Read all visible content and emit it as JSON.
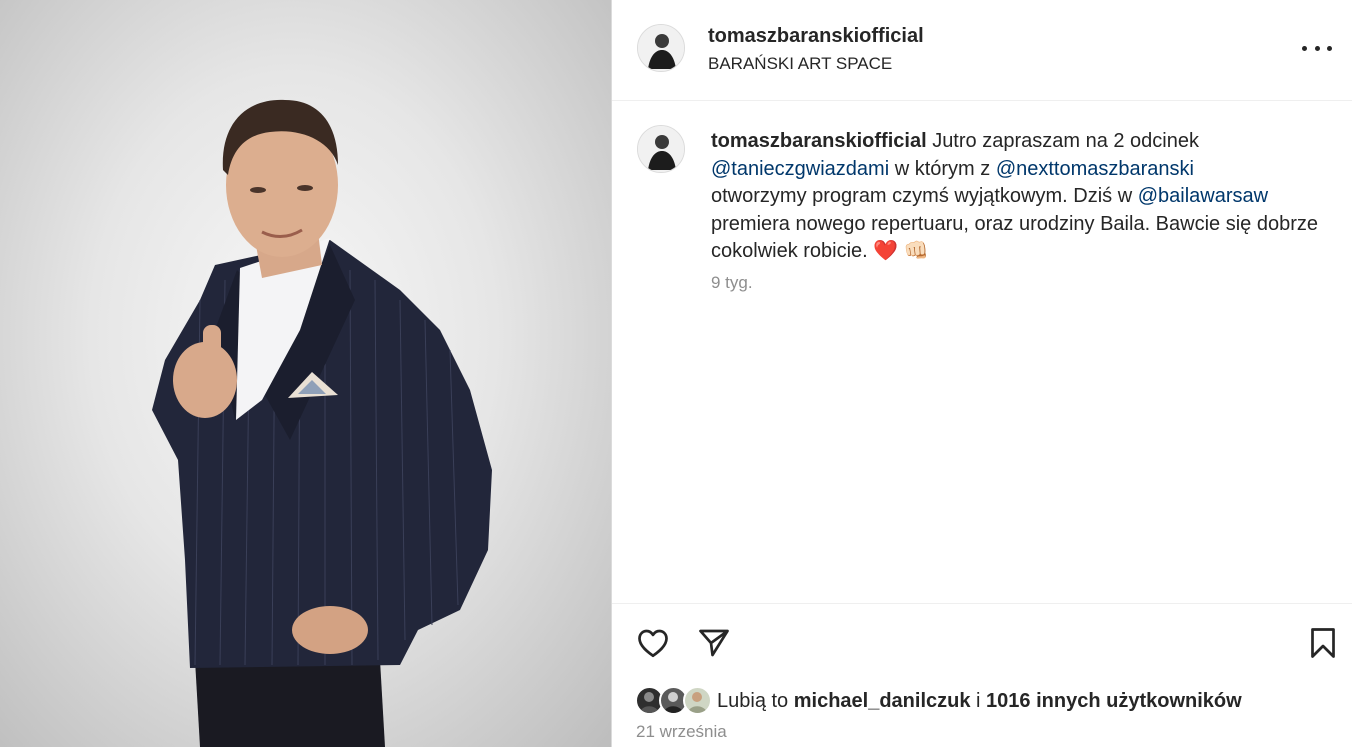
{
  "post": {
    "author": "tomaszbaranskiofficial",
    "location": "BARAŃSKI ART SPACE",
    "caption": {
      "part1": "Jutro zapraszam na 2 odcinek",
      "mention1": "@tanieczgwiazdami",
      "part2": " w którym z ",
      "mention2": "@nexttomaszbaranski",
      "part3": "otworzymy program czymś wyjątkowym. Dziś w ",
      "mention3": "@bailawarsaw",
      "part4": "premiera nowego repertuaru, oraz urodziny Baila. Bawcie się dobrze cokolwiek robicie. ",
      "emoji1": "❤️",
      "emoji2": "👊🏻"
    },
    "time_ago": "9 tyg.",
    "likes": {
      "prefix": "Lubią to ",
      "user": "michael_danilczuk",
      "connector": " i ",
      "others": "1016 innych użytkowników"
    },
    "date": "21 września"
  },
  "icons": {
    "more": "more-options-icon",
    "like": "heart-outline-icon",
    "share": "paper-plane-icon",
    "save": "bookmark-icon"
  },
  "colors": {
    "mention": "#00376b",
    "secondary_text": "#8e8e8e",
    "text": "#262626"
  }
}
